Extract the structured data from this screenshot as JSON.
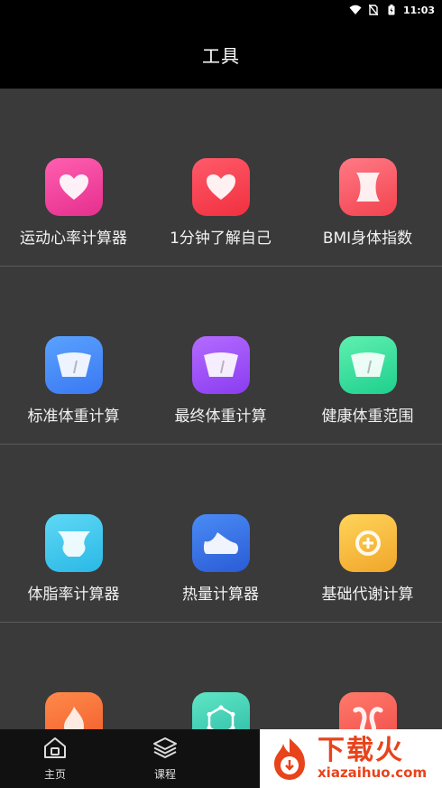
{
  "status_bar": {
    "time": "11:03"
  },
  "app_bar": {
    "title": "工具"
  },
  "tools": [
    {
      "label": "运动心率计算器",
      "icon": "heart-icon",
      "gradient": [
        "#ff5fb0",
        "#e52f8e"
      ]
    },
    {
      "label": "1分钟了解自己",
      "icon": "heart-icon",
      "gradient": [
        "#ff5a6a",
        "#f0303f"
      ]
    },
    {
      "label": "BMI身体指数",
      "icon": "waist-icon",
      "gradient": [
        "#ff7a85",
        "#f2434f"
      ]
    },
    {
      "label": "标准体重计算",
      "icon": "scale-icon",
      "gradient": [
        "#5aa2ff",
        "#3a78f2"
      ]
    },
    {
      "label": "最终体重计算",
      "icon": "scale-icon",
      "gradient": [
        "#b46bff",
        "#8a3cf0"
      ]
    },
    {
      "label": "健康体重范围",
      "icon": "scale-icon",
      "gradient": [
        "#5ff0b0",
        "#1fcf8e"
      ]
    },
    {
      "label": "体脂率计算器",
      "icon": "body-icon",
      "gradient": [
        "#5fd8f5",
        "#2ab8e6"
      ]
    },
    {
      "label": "热量计算器",
      "icon": "shoe-icon",
      "gradient": [
        "#4a8cf5",
        "#2a5bd6"
      ]
    },
    {
      "label": "基础代谢计算",
      "icon": "cycle-icon",
      "gradient": [
        "#ffd45a",
        "#f0a62a"
      ]
    },
    {
      "label": "",
      "icon": "flame-icon",
      "gradient": [
        "#ff8a4a",
        "#f05a2a"
      ]
    },
    {
      "label": "",
      "icon": "hexagon-icon",
      "gradient": [
        "#5fe6c4",
        "#2ab8a6"
      ]
    },
    {
      "label": "",
      "icon": "bone-icon",
      "gradient": [
        "#ff7a6a",
        "#f04a4a"
      ]
    }
  ],
  "tab_bar": {
    "tabs": [
      {
        "label": "主页",
        "icon": "home-icon"
      },
      {
        "label": "课程",
        "icon": "layers-icon"
      }
    ]
  },
  "watermark": {
    "title": "下载火",
    "url": "xiazaihuo.com"
  }
}
